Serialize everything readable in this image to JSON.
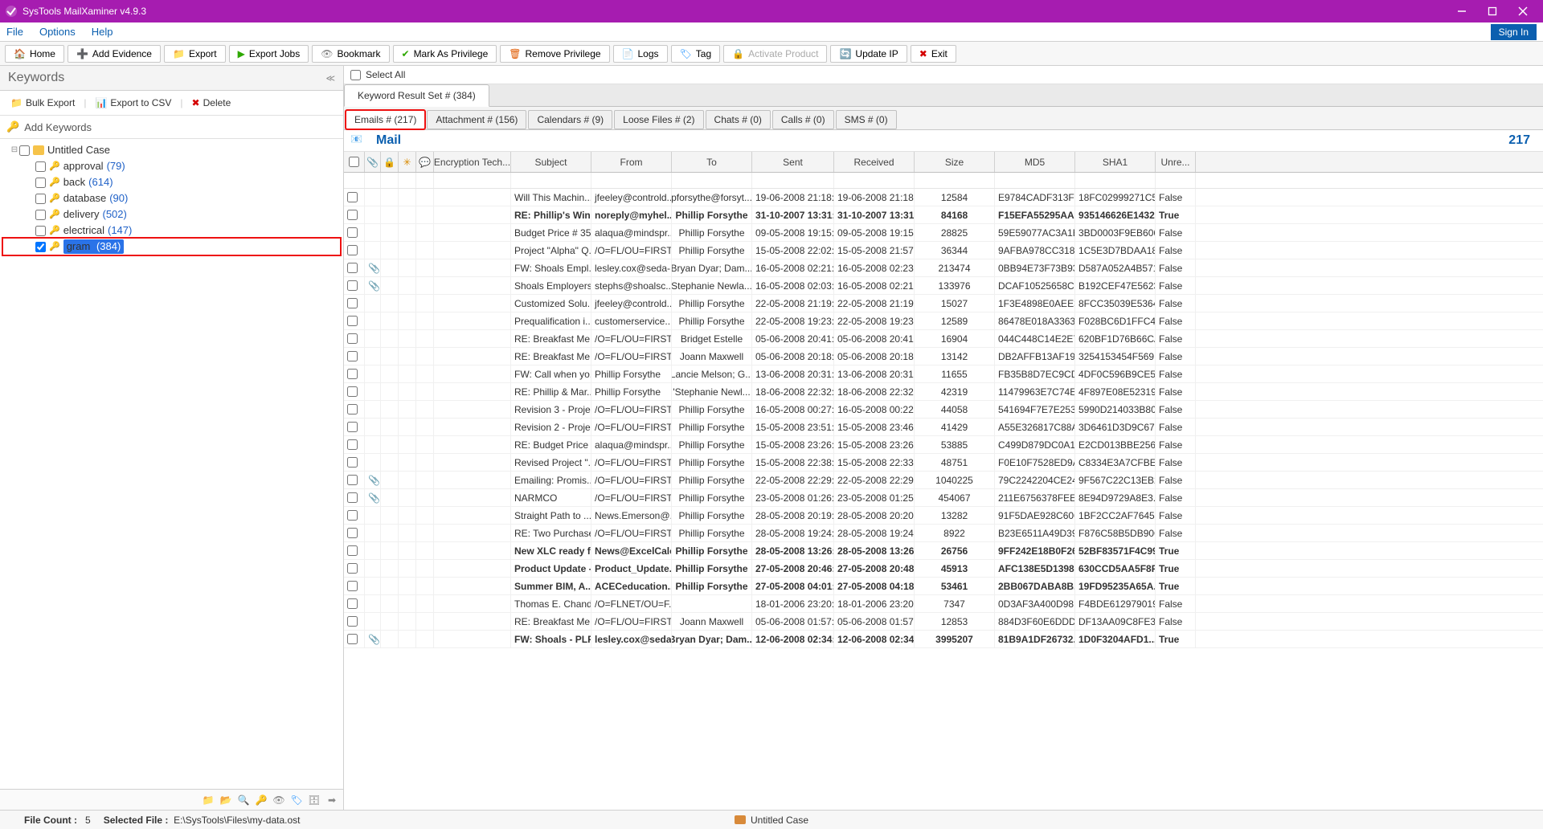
{
  "app": {
    "title": "SysTools MailXaminer v4.9.3"
  },
  "menu": {
    "file": "File",
    "options": "Options",
    "help": "Help",
    "signin": "Sign In"
  },
  "toolbar": {
    "home": "Home",
    "add_evidence": "Add Evidence",
    "export": "Export",
    "export_jobs": "Export Jobs",
    "bookmark": "Bookmark",
    "mark_priv": "Mark As Privilege",
    "remove_priv": "Remove Privilege",
    "logs": "Logs",
    "tag": "Tag",
    "activate": "Activate Product",
    "update_ip": "Update IP",
    "exit": "Exit"
  },
  "left": {
    "title": "Keywords",
    "bulk_export": "Bulk Export",
    "export_csv": "Export to CSV",
    "delete": "Delete",
    "add_keywords": "Add Keywords",
    "root": "Untitled Case",
    "items": [
      {
        "name": "approval",
        "count": "(79)"
      },
      {
        "name": "back",
        "count": "(614)"
      },
      {
        "name": "database",
        "count": "(90)"
      },
      {
        "name": "delivery",
        "count": "(502)"
      },
      {
        "name": "electrical",
        "count": "(147)"
      },
      {
        "name": "gram",
        "count": "(384)"
      }
    ]
  },
  "right": {
    "select_all": "Select All",
    "filetab": "Keyword Result Set # (384)",
    "subtabs": [
      "Emails # (217)",
      "Attachment # (156)",
      "Calendars # (9)",
      "Loose Files # (2)",
      "Chats # (0)",
      "Calls # (0)",
      "SMS # (0)"
    ],
    "mail_label": "Mail",
    "mail_count": "217",
    "headers": {
      "enc": "Encryption Tech...",
      "subject": "Subject",
      "from": "From",
      "to": "To",
      "sent": "Sent",
      "received": "Received",
      "size": "Size",
      "md5": "MD5",
      "sha1": "SHA1",
      "unread": "Unre..."
    }
  },
  "rows": [
    {
      "bold": false,
      "att": false,
      "subject": "Will This Machin...",
      "from": "jfeeley@controld...",
      "to": "pforsythe@forsyt...",
      "sent": "19-06-2008 21:18:...",
      "recv": "19-06-2008 21:18:...",
      "size": "12584",
      "md5": "E9784CADF313F5...",
      "sha1": "18FC02999271C5...",
      "unread": "False"
    },
    {
      "bold": true,
      "att": false,
      "subject": "RE: Phillip's Win...",
      "from": "noreply@myhel...",
      "to": "Phillip Forsythe",
      "sent": "31-10-2007 13:31:...",
      "recv": "31-10-2007 13:31:...",
      "size": "84168",
      "md5": "F15EFA55295AA8...",
      "sha1": "935146626E1432...",
      "unread": "True"
    },
    {
      "bold": false,
      "att": false,
      "subject": "Budget Price # 35...",
      "from": "alaqua@mindspr...",
      "to": "Phillip Forsythe",
      "sent": "09-05-2008 19:15:...",
      "recv": "09-05-2008 19:15:...",
      "size": "28825",
      "md5": "59E59077AC3A1B...",
      "sha1": "3BD0003F9EB606...",
      "unread": "False"
    },
    {
      "bold": false,
      "att": false,
      "subject": "Project \"Alpha\" Q...",
      "from": "/O=FL/OU=FIRST...",
      "to": "Phillip Forsythe",
      "sent": "15-05-2008 22:02:...",
      "recv": "15-05-2008 21:57:...",
      "size": "36344",
      "md5": "9AFBA978CC3180...",
      "sha1": "1C5E3D7BDAA18...",
      "unread": "False"
    },
    {
      "bold": false,
      "att": true,
      "subject": "FW: Shoals Empl...",
      "from": "lesley.cox@seda-...",
      "to": "Bryan Dyar; Dam...",
      "sent": "16-05-2008 02:21:...",
      "recv": "16-05-2008 02:23:...",
      "size": "213474",
      "md5": "0BB94E73F73B93...",
      "sha1": "D587A052A4B571...",
      "unread": "False"
    },
    {
      "bold": false,
      "att": true,
      "subject": "Shoals Employers...",
      "from": "stephs@shoalsc...",
      "to": "Stephanie Newla...",
      "sent": "16-05-2008 02:03:...",
      "recv": "16-05-2008 02:21:...",
      "size": "133976",
      "md5": "DCAF10525658CF...",
      "sha1": "B192CEF47E5623...",
      "unread": "False"
    },
    {
      "bold": false,
      "att": false,
      "subject": "Customized Solu...",
      "from": "jfeeley@controld...",
      "to": "Phillip Forsythe",
      "sent": "22-05-2008 21:19:...",
      "recv": "22-05-2008 21:19:...",
      "size": "15027",
      "md5": "1F3E4898E0AEE3...",
      "sha1": "8FCC35039E5364...",
      "unread": "False"
    },
    {
      "bold": false,
      "att": false,
      "subject": "Prequalification i...",
      "from": "customerservice...",
      "to": "Phillip Forsythe",
      "sent": "22-05-2008 19:23:...",
      "recv": "22-05-2008 19:23:...",
      "size": "12589",
      "md5": "86478E018A3363...",
      "sha1": "F028BC6D1FFC40...",
      "unread": "False"
    },
    {
      "bold": false,
      "att": false,
      "subject": "RE: Breakfast Me...",
      "from": "/O=FL/OU=FIRST...",
      "to": "Bridget Estelle",
      "sent": "05-06-2008 20:41:...",
      "recv": "05-06-2008 20:41:...",
      "size": "16904",
      "md5": "044C448C14E2E7...",
      "sha1": "620BF1D76B66CA...",
      "unread": "False"
    },
    {
      "bold": false,
      "att": false,
      "subject": "RE: Breakfast Me...",
      "from": "/O=FL/OU=FIRST...",
      "to": "Joann Maxwell",
      "sent": "05-06-2008 20:18:...",
      "recv": "05-06-2008 20:18:...",
      "size": "13142",
      "md5": "DB2AFFB13AF197...",
      "sha1": "3254153454F569...",
      "unread": "False"
    },
    {
      "bold": false,
      "att": false,
      "subject": "FW: Call when yo...",
      "from": "Phillip Forsythe",
      "to": "Lancie Melson; G...",
      "sent": "13-06-2008 20:31:...",
      "recv": "13-06-2008 20:31:...",
      "size": "11655",
      "md5": "FB35B8D7EC9CD...",
      "sha1": "4DF0C596B9CE5...",
      "unread": "False"
    },
    {
      "bold": false,
      "att": false,
      "subject": "RE: Phillip & Mar...",
      "from": "Phillip Forsythe",
      "to": "'Stephanie Newl...",
      "sent": "18-06-2008 22:32:...",
      "recv": "18-06-2008 22:32:...",
      "size": "42319",
      "md5": "11479963E7C74E...",
      "sha1": "4F897E08E52319...",
      "unread": "False"
    },
    {
      "bold": false,
      "att": false,
      "subject": "Revision 3 - Proje...",
      "from": "/O=FL/OU=FIRST...",
      "to": "Phillip Forsythe",
      "sent": "16-05-2008 00:27:...",
      "recv": "16-05-2008 00:22:...",
      "size": "44058",
      "md5": "541694F7E7E253...",
      "sha1": "5990D214033B80...",
      "unread": "False"
    },
    {
      "bold": false,
      "att": false,
      "subject": "Revision 2 - Proje...",
      "from": "/O=FL/OU=FIRST...",
      "to": "Phillip Forsythe",
      "sent": "15-05-2008 23:51:...",
      "recv": "15-05-2008 23:46:...",
      "size": "41429",
      "md5": "A55E326817C88A...",
      "sha1": "3D6461D3D9C67...",
      "unread": "False"
    },
    {
      "bold": false,
      "att": false,
      "subject": "RE: Budget Price ...",
      "from": "alaqua@mindspr...",
      "to": "Phillip Forsythe",
      "sent": "15-05-2008 23:26:...",
      "recv": "15-05-2008 23:26:...",
      "size": "53885",
      "md5": "C499D879DC0A1...",
      "sha1": "E2CD013BBE2563...",
      "unread": "False"
    },
    {
      "bold": false,
      "att": false,
      "subject": "Revised Project \"...",
      "from": "/O=FL/OU=FIRST...",
      "to": "Phillip Forsythe",
      "sent": "15-05-2008 22:38:...",
      "recv": "15-05-2008 22:33:...",
      "size": "48751",
      "md5": "F0E10F7528ED9A...",
      "sha1": "C8334E3A7CFBED...",
      "unread": "False"
    },
    {
      "bold": false,
      "att": true,
      "subject": "Emailing: Promis...",
      "from": "/O=FL/OU=FIRST...",
      "to": "Phillip Forsythe",
      "sent": "22-05-2008 22:29:...",
      "recv": "22-05-2008 22:29:...",
      "size": "1040225",
      "md5": "79C2242204CE24...",
      "sha1": "9F567C22C13EB2...",
      "unread": "False"
    },
    {
      "bold": false,
      "att": true,
      "subject": "NARMCO",
      "from": "/O=FL/OU=FIRST...",
      "to": "Phillip Forsythe",
      "sent": "23-05-2008 01:26:...",
      "recv": "23-05-2008 01:25:...",
      "size": "454067",
      "md5": "211E6756378FEE...",
      "sha1": "8E94D9729A8E3...",
      "unread": "False"
    },
    {
      "bold": false,
      "att": false,
      "subject": "Straight Path to ...",
      "from": "News.Emerson@...",
      "to": "Phillip Forsythe",
      "sent": "28-05-2008 20:19:...",
      "recv": "28-05-2008 20:20:...",
      "size": "13282",
      "md5": "91F5DAE928C606...",
      "sha1": "1BF2CC2AF76457...",
      "unread": "False"
    },
    {
      "bold": false,
      "att": false,
      "subject": "RE: Two Purchase...",
      "from": "/O=FL/OU=FIRST...",
      "to": "Phillip Forsythe",
      "sent": "28-05-2008 19:24:...",
      "recv": "28-05-2008 19:24:...",
      "size": "8922",
      "md5": "B23E6511A49D39...",
      "sha1": "F876C58B5DB90C...",
      "unread": "False"
    },
    {
      "bold": true,
      "att": false,
      "subject": "New XLC ready f...",
      "from": "News@ExcelCalc...",
      "to": "Phillip Forsythe",
      "sent": "28-05-2008 13:26:...",
      "recv": "28-05-2008 13:26:...",
      "size": "26756",
      "md5": "9FF242E18B0F26...",
      "sha1": "52BF83571F4C99...",
      "unread": "True"
    },
    {
      "bold": true,
      "att": false,
      "subject": "Product Update -...",
      "from": "Product_Update...",
      "to": "Phillip Forsythe",
      "sent": "27-05-2008 20:46:...",
      "recv": "27-05-2008 20:48:...",
      "size": "45913",
      "md5": "AFC138E5D1398...",
      "sha1": "630CCD5AA5F8F...",
      "unread": "True"
    },
    {
      "bold": true,
      "att": false,
      "subject": "Summer  BIM, A...",
      "from": "ACECeducation...",
      "to": "Phillip Forsythe",
      "sent": "27-05-2008 04:01:...",
      "recv": "27-05-2008 04:18:...",
      "size": "53461",
      "md5": "2BB067DABA8B...",
      "sha1": "19FD95235A65A...",
      "unread": "True"
    },
    {
      "bold": false,
      "att": false,
      "subject": "Thomas E. Chand...",
      "from": "/O=FLNET/OU=F...",
      "to": "",
      "sent": "18-01-2006 23:20:...",
      "recv": "18-01-2006 23:20:...",
      "size": "7347",
      "md5": "0D3AF3A400D98...",
      "sha1": "F4BDE612979019...",
      "unread": "False"
    },
    {
      "bold": false,
      "att": false,
      "subject": "RE: Breakfast Me...",
      "from": "/O=FL/OU=FIRST...",
      "to": "Joann Maxwell",
      "sent": "05-06-2008 01:57:...",
      "recv": "05-06-2008 01:57:...",
      "size": "12853",
      "md5": "884D3F60E6DDD...",
      "sha1": "DF13AA09C8FE3...",
      "unread": "False"
    },
    {
      "bold": true,
      "att": true,
      "subject": "FW: Shoals - PLF",
      "from": "lesley.cox@seda-...",
      "to": "Bryan Dyar; Dam...",
      "sent": "12-06-2008 02:34:...",
      "recv": "12-06-2008 02:34:...",
      "size": "3995207",
      "md5": "81B9A1DF26732...",
      "sha1": "1D0F3204AFD1...",
      "unread": "True"
    }
  ],
  "status": {
    "file_count_label": "File Count :",
    "file_count_value": "5",
    "selected_label": "Selected File :",
    "selected_value": "E:\\SysTools\\Files\\my-data.ost",
    "center": "Untitled Case"
  }
}
